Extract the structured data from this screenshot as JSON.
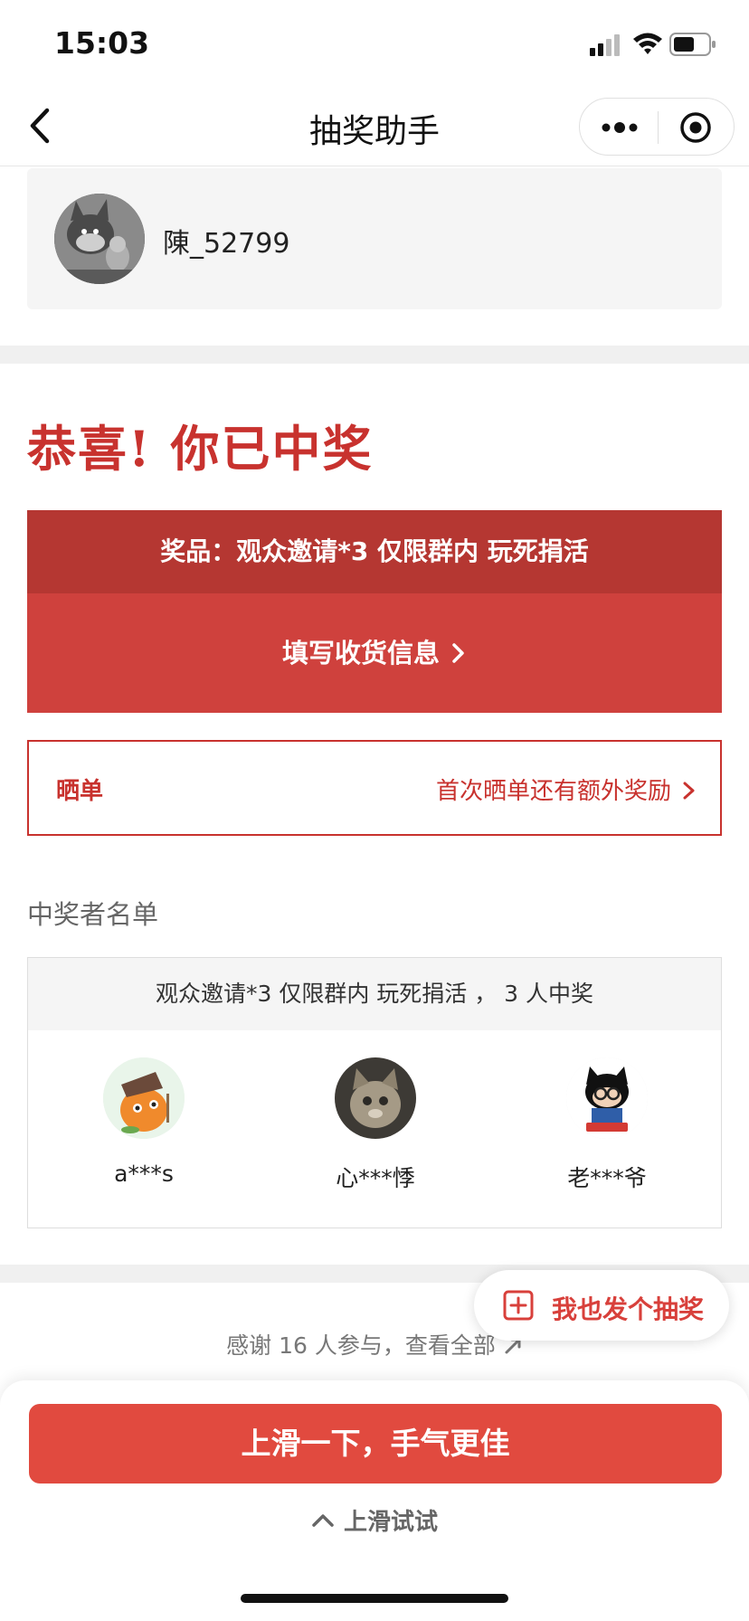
{
  "status_bar": {
    "time": "15:03"
  },
  "nav": {
    "title": "抽奖助手"
  },
  "user": {
    "name": "陳_52799"
  },
  "congrats": "恭喜! 你已中奖",
  "prize": {
    "header": "奖品：观众邀请*3 仅限群内 玩死捐活",
    "action": "填写收货信息"
  },
  "share": {
    "label": "晒单",
    "hint": "首次晒单还有额外奖励"
  },
  "winners": {
    "heading": "中奖者名单",
    "summary": "观众邀请*3 仅限群内 玩死捐活 ， 3 人中奖",
    "list": [
      {
        "name": "a***s"
      },
      {
        "name": "心***悸"
      },
      {
        "name": "老***爷"
      }
    ]
  },
  "thanks": "感谢 16 人参与，查看全部",
  "fab": {
    "label": "我也发个抽奖"
  },
  "bottom": {
    "button": "上滑一下，手气更佳",
    "hint": "上滑试试"
  },
  "colors": {
    "accent": "#c8322e",
    "banner_dark": "#b53732",
    "banner": "#cf413d",
    "button": "#e14a3f"
  }
}
